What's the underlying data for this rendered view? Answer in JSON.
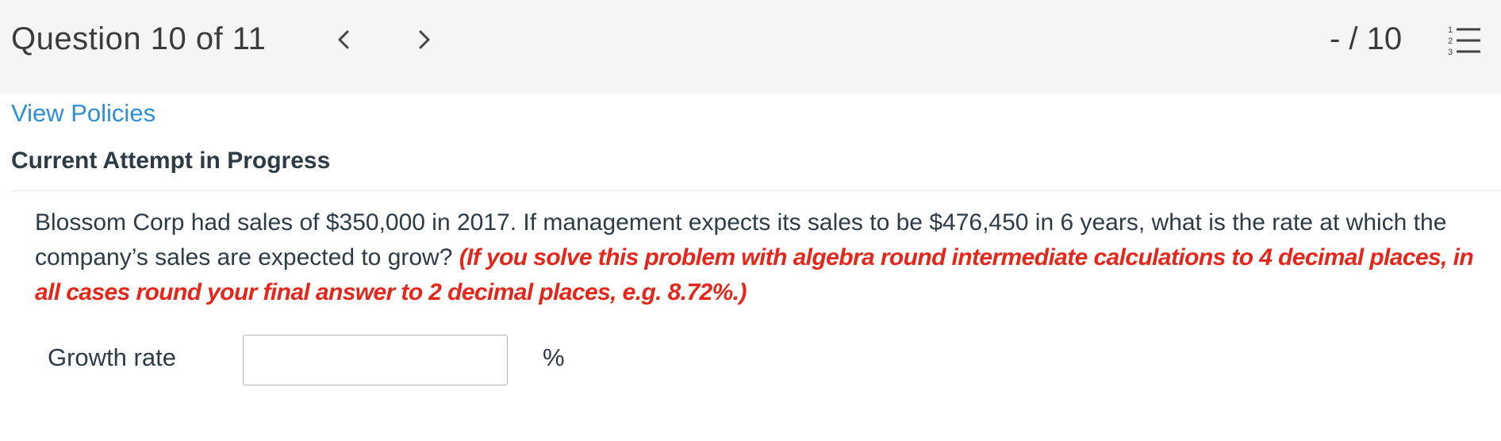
{
  "header": {
    "question_counter": "Question 10 of 11",
    "prev_icon": "chevron-left-icon",
    "next_icon": "chevron-right-icon",
    "score": "- / 10",
    "list_icon": "numbered-list-icon"
  },
  "links": {
    "view_policies": "View Policies"
  },
  "attempt": {
    "heading": "Current Attempt in Progress"
  },
  "question": {
    "text": "Blossom Corp had sales of $350,000 in 2017. If management expects its sales to be $476,450 in 6 years, what is the rate at which the company’s sales are expected to grow?",
    "instruction": "(If you solve this problem with algebra round intermediate calculations to 4 decimal places, in all cases round your final answer to 2 decimal places, e.g. 8.72%.)"
  },
  "answer": {
    "label": "Growth rate",
    "value": "",
    "unit": "%"
  },
  "colors": {
    "header_bg": "#f5f5f5",
    "link": "#2d8fd5",
    "instruction": "#e4271b",
    "text": "#2d3b45"
  }
}
